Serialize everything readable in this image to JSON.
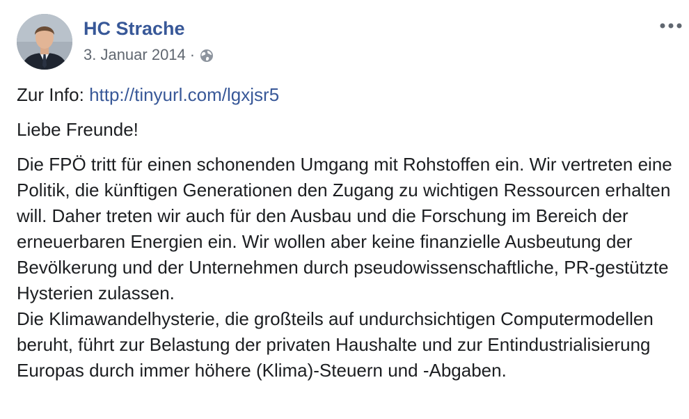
{
  "author": {
    "name": "HC Strache"
  },
  "meta": {
    "date": "3. Januar 2014",
    "separator": "·",
    "privacy_icon": "globe-icon"
  },
  "menu": {
    "icon": "more-options-icon"
  },
  "body": {
    "info_prefix": "Zur Info:",
    "info_link": "http://tinyurl.com/lgxjsr5",
    "greeting": "Liebe Freunde!",
    "paragraph_1": "Die FPÖ tritt für einen schonenden Umgang mit Rohstoffen ein. Wir vertreten eine Politik, die künftigen Generationen den Zugang zu wichtigen Ressourcen erhalten will. Daher treten wir auch für den Ausbau und die Forschung im Bereich der erneuerbaren Energien ein. Wir wollen aber keine finanzielle Ausbeutung der Bevölkerung und der Unternehmen durch pseudowissenschaftliche, PR-gestützte Hysterien zulassen.",
    "paragraph_2": "Die Klimawandelhysterie, die großteils auf undurchsichtigen Computermodellen beruht, führt zur Belastung der privaten Haushalte und zur Entindustrialisierung Europas durch immer höhere (Klima)-Steuern und -Abgaben."
  },
  "colors": {
    "link": "#385898",
    "text": "#1c1e21",
    "meta": "#606770"
  }
}
